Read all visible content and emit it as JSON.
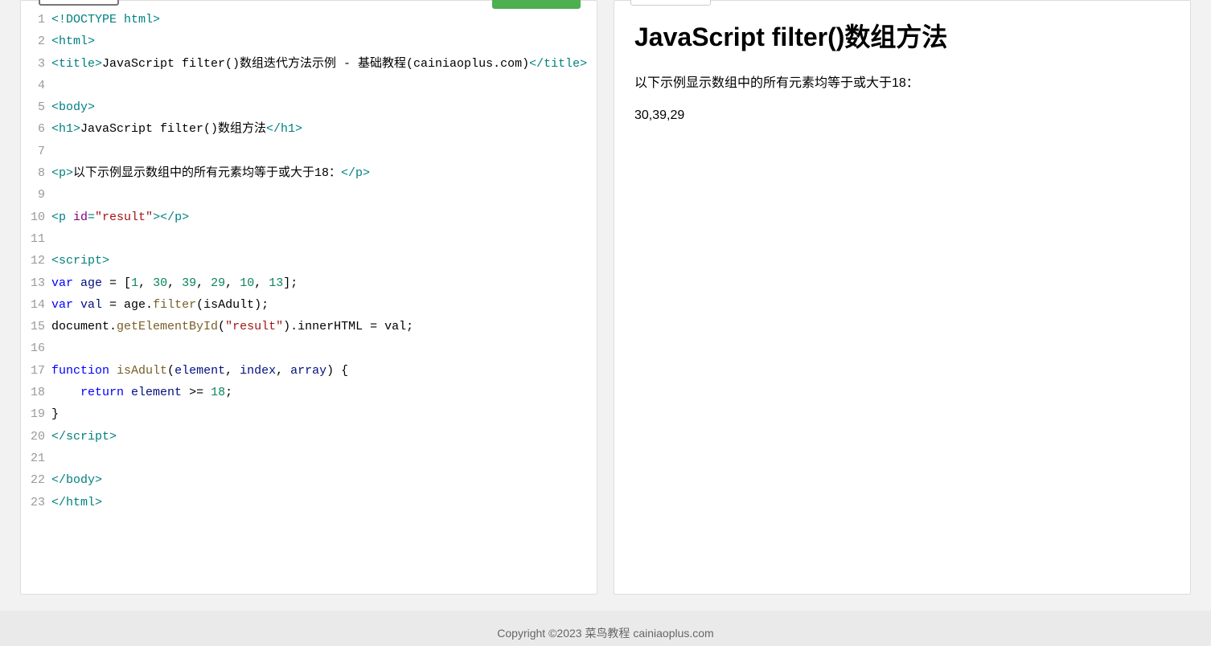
{
  "code": {
    "lines": [
      [
        {
          "cls": "t-tag",
          "t": "<!DOCTYPE html>"
        }
      ],
      [
        {
          "cls": "t-tag",
          "t": "<html>"
        }
      ],
      [
        {
          "cls": "t-tag",
          "t": "<title>"
        },
        {
          "cls": "",
          "t": "JavaScript filter()数组迭代方法示例 - 基础教程(cainiaoplus.com)"
        },
        {
          "cls": "t-tag",
          "t": "</title>"
        }
      ],
      [
        {
          "cls": "",
          "t": ""
        }
      ],
      [
        {
          "cls": "t-tag",
          "t": "<body>"
        }
      ],
      [
        {
          "cls": "t-tag",
          "t": "<h1>"
        },
        {
          "cls": "",
          "t": "JavaScript filter()数组方法"
        },
        {
          "cls": "t-tag",
          "t": "</h1>"
        }
      ],
      [
        {
          "cls": "",
          "t": ""
        }
      ],
      [
        {
          "cls": "t-tag",
          "t": "<p>"
        },
        {
          "cls": "",
          "t": "以下示例显示数组中的所有元素均等于或大于18："
        },
        {
          "cls": "t-tag",
          "t": "</p>"
        }
      ],
      [
        {
          "cls": "",
          "t": ""
        }
      ],
      [
        {
          "cls": "t-tag",
          "t": "<p "
        },
        {
          "cls": "t-attr",
          "t": "id"
        },
        {
          "cls": "t-tag",
          "t": "="
        },
        {
          "cls": "t-str",
          "t": "\"result\""
        },
        {
          "cls": "t-tag",
          "t": "></p>"
        }
      ],
      [
        {
          "cls": "",
          "t": ""
        }
      ],
      [
        {
          "cls": "t-tag",
          "t": "<script>"
        }
      ],
      [
        {
          "cls": "t-kw",
          "t": "var"
        },
        {
          "cls": "",
          "t": " "
        },
        {
          "cls": "t-var",
          "t": "age"
        },
        {
          "cls": "",
          "t": " = ["
        },
        {
          "cls": "t-num",
          "t": "1"
        },
        {
          "cls": "",
          "t": ", "
        },
        {
          "cls": "t-num",
          "t": "30"
        },
        {
          "cls": "",
          "t": ", "
        },
        {
          "cls": "t-num",
          "t": "39"
        },
        {
          "cls": "",
          "t": ", "
        },
        {
          "cls": "t-num",
          "t": "29"
        },
        {
          "cls": "",
          "t": ", "
        },
        {
          "cls": "t-num",
          "t": "10"
        },
        {
          "cls": "",
          "t": ", "
        },
        {
          "cls": "t-num",
          "t": "13"
        },
        {
          "cls": "",
          "t": "];"
        }
      ],
      [
        {
          "cls": "t-kw",
          "t": "var"
        },
        {
          "cls": "",
          "t": " "
        },
        {
          "cls": "t-var",
          "t": "val"
        },
        {
          "cls": "",
          "t": " = age."
        },
        {
          "cls": "t-fn",
          "t": "filter"
        },
        {
          "cls": "",
          "t": "(isAdult);"
        }
      ],
      [
        {
          "cls": "",
          "t": "document."
        },
        {
          "cls": "t-fn",
          "t": "getElementById"
        },
        {
          "cls": "",
          "t": "("
        },
        {
          "cls": "t-str",
          "t": "\"result\""
        },
        {
          "cls": "",
          "t": ").innerHTML = val;"
        }
      ],
      [
        {
          "cls": "",
          "t": ""
        }
      ],
      [
        {
          "cls": "t-kw",
          "t": "function"
        },
        {
          "cls": "",
          "t": " "
        },
        {
          "cls": "t-fn",
          "t": "isAdult"
        },
        {
          "cls": "",
          "t": "("
        },
        {
          "cls": "t-var",
          "t": "element"
        },
        {
          "cls": "",
          "t": ", "
        },
        {
          "cls": "t-var",
          "t": "index"
        },
        {
          "cls": "",
          "t": ", "
        },
        {
          "cls": "t-var",
          "t": "array"
        },
        {
          "cls": "",
          "t": ") {"
        }
      ],
      [
        {
          "cls": "",
          "t": "    "
        },
        {
          "cls": "t-kw",
          "t": "return"
        },
        {
          "cls": "",
          "t": " "
        },
        {
          "cls": "t-var",
          "t": "element"
        },
        {
          "cls": "",
          "t": " >= "
        },
        {
          "cls": "t-num",
          "t": "18"
        },
        {
          "cls": "",
          "t": ";"
        }
      ],
      [
        {
          "cls": "",
          "t": "}"
        }
      ],
      [
        {
          "cls": "t-tag",
          "t": "</scr"
        },
        {
          "cls": "t-tag",
          "t": "ipt>"
        }
      ],
      [
        {
          "cls": "",
          "t": ""
        }
      ],
      [
        {
          "cls": "t-tag",
          "t": "</body>"
        }
      ],
      [
        {
          "cls": "t-tag",
          "t": "</html>"
        }
      ]
    ]
  },
  "preview": {
    "heading": "JavaScript filter()数组方法",
    "desc": "以下示例显示数组中的所有元素均等于或大于18：",
    "result": "30,39,29"
  },
  "footer": "Copyright ©2023 菜鸟教程 cainiaoplus.com"
}
